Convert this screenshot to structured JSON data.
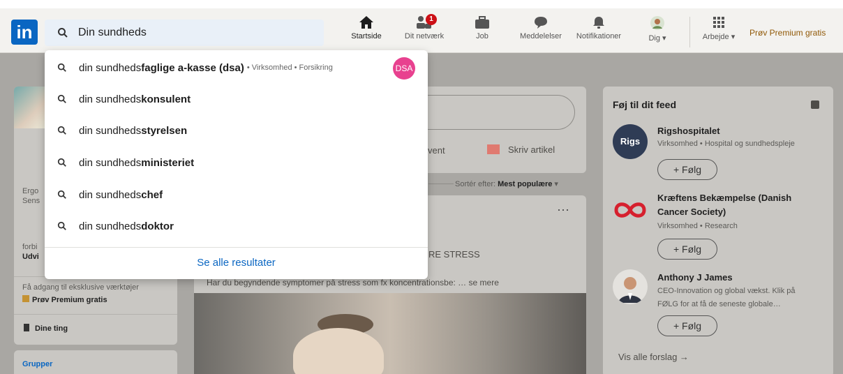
{
  "search": {
    "value": "Din sundheds",
    "suggestions": [
      {
        "prefix": "din sundheds",
        "bold": "faglige a-kasse (dsa)",
        "meta": "• Virksomhed • Forsikring",
        "logo": "DSA"
      },
      {
        "prefix": "din sundheds",
        "bold": "konsulent"
      },
      {
        "prefix": "din sundheds",
        "bold": "styrelsen"
      },
      {
        "prefix": "din sundheds",
        "bold": "ministeriet"
      },
      {
        "prefix": "din sundheds",
        "bold": "chef"
      },
      {
        "prefix": "din sundheds",
        "bold": "doktor"
      }
    ],
    "see_all": "Se alle resultater"
  },
  "nav": {
    "home": "Startside",
    "network": "Dit netværk",
    "network_badge": "1",
    "jobs": "Job",
    "messages": "Meddelelser",
    "notifications": "Notifikationer",
    "me": "Dig",
    "work": "Arbejde",
    "premium": "Prøv Premium gratis"
  },
  "left": {
    "line1": "Ergo",
    "line2": "Sens",
    "line3": "forbi",
    "line4": "Udvi",
    "premium_hint": "Få adgang til eksklusive værktøjer",
    "premium_link": "Prøv Premium gratis",
    "my_items": "Dine ting",
    "groups": "Grupper"
  },
  "middle": {
    "event": "vent",
    "article": "Skriv artikel",
    "sort_label": "Sortér efter:",
    "sort_value": "Mest populære",
    "post_headline": "RE STRESS",
    "post_text": "Har du begyndende symptomer på stress som fx koncentrationsbe: … se mere"
  },
  "right": {
    "title": "Føj til dit feed",
    "items": [
      {
        "name": "Rigshospitalet",
        "sub": "Virksomhed • Hospital og sundhedspleje",
        "follow": "+ Følg",
        "logo": "Rigs"
      },
      {
        "name": "Kræftens Bekæmpelse (Danish",
        "name2": "Cancer Society)",
        "sub": "Virksomhed • Research",
        "follow": "+ Følg"
      },
      {
        "name": "Anthony J James",
        "sub": "CEO-Innovation og global vækst. Klik på",
        "sub2": "FØLG for at få de seneste globale…",
        "follow": "+ Følg"
      }
    ],
    "see_all": "Vis alle forslag →"
  },
  "colors": {
    "brand": "#0a66c2",
    "premium": "#915907",
    "badge": "#cc1016",
    "annotation_arrow": "#ef7d22"
  }
}
